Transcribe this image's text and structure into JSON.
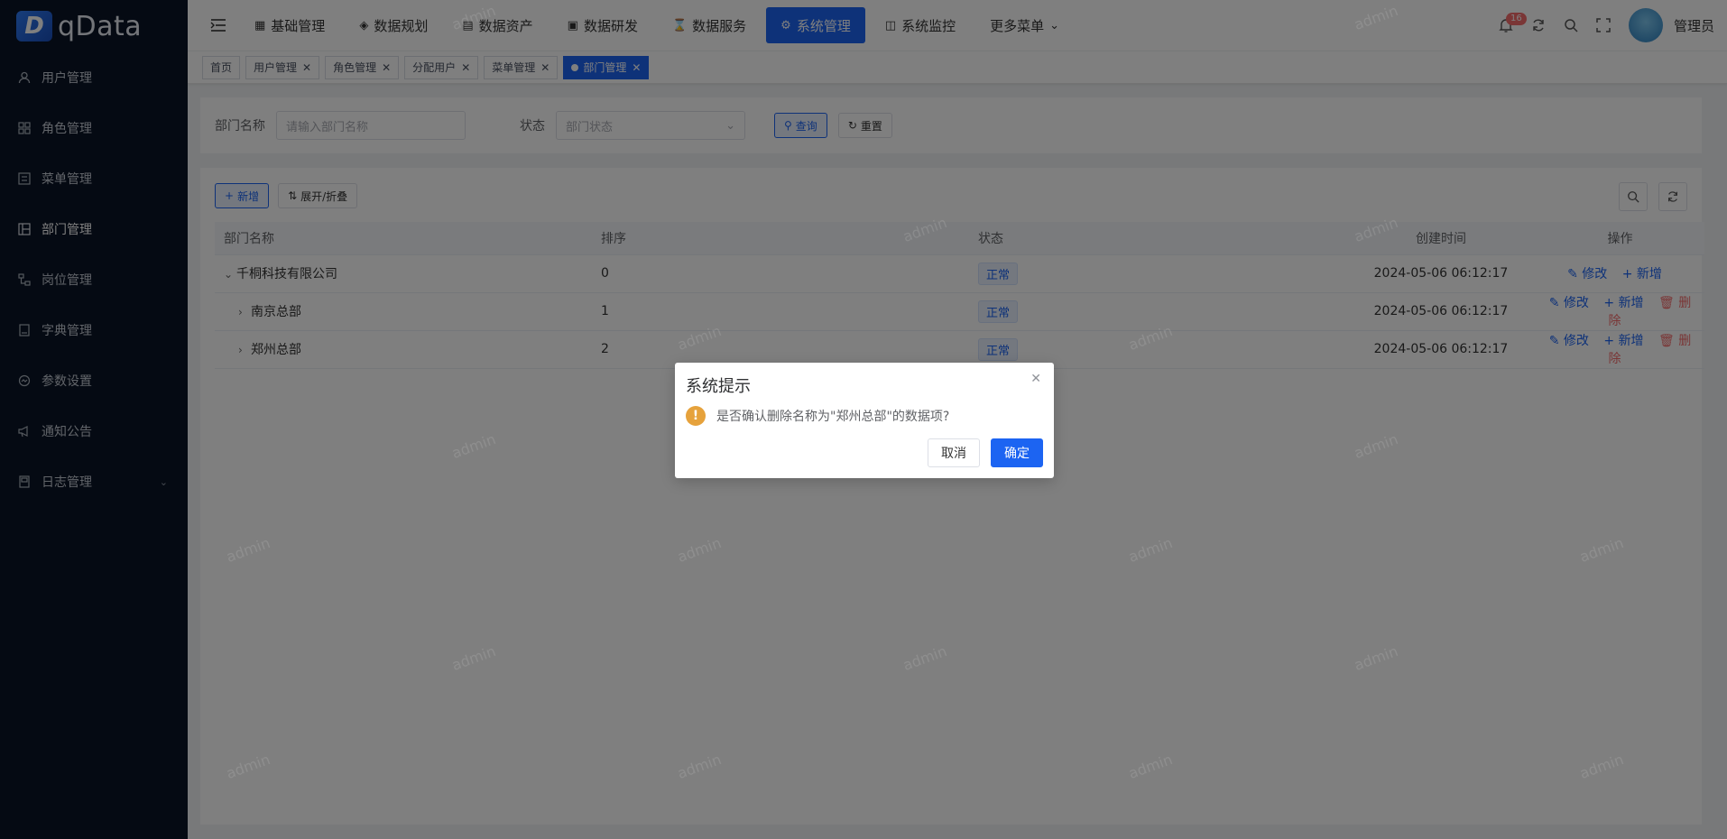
{
  "app": {
    "logo_letter": "D",
    "logo_text": "qData"
  },
  "sidebar": {
    "items": [
      {
        "label": "用户管理",
        "icon": "user-icon"
      },
      {
        "label": "角色管理",
        "icon": "role-icon"
      },
      {
        "label": "菜单管理",
        "icon": "menu-icon"
      },
      {
        "label": "部门管理",
        "icon": "department-icon"
      },
      {
        "label": "岗位管理",
        "icon": "post-icon"
      },
      {
        "label": "字典管理",
        "icon": "dictionary-icon"
      },
      {
        "label": "参数设置",
        "icon": "settings-icon"
      },
      {
        "label": "通知公告",
        "icon": "notice-icon"
      },
      {
        "label": "日志管理",
        "icon": "log-icon"
      }
    ]
  },
  "topnav": {
    "items": [
      {
        "label": "基础管理"
      },
      {
        "label": "数据规划"
      },
      {
        "label": "数据资产"
      },
      {
        "label": "数据研发"
      },
      {
        "label": "数据服务"
      },
      {
        "label": "系统管理"
      },
      {
        "label": "系统监控"
      },
      {
        "label": "更多菜单"
      }
    ],
    "notification_count": "16",
    "username": "管理员"
  },
  "tags": [
    {
      "label": "首页"
    },
    {
      "label": "用户管理"
    },
    {
      "label": "角色管理"
    },
    {
      "label": "分配用户"
    },
    {
      "label": "菜单管理"
    },
    {
      "label": "部门管理"
    }
  ],
  "search": {
    "dept_label": "部门名称",
    "dept_placeholder": "请输入部门名称",
    "status_label": "状态",
    "status_placeholder": "部门状态",
    "query_btn": "查询",
    "reset_btn": "重置"
  },
  "toolbar": {
    "add_btn": "新增",
    "expand_btn": "展开/折叠"
  },
  "table": {
    "headers": {
      "name": "部门名称",
      "order": "排序",
      "status": "状态",
      "created": "创建时间",
      "ops": "操作"
    },
    "rows": [
      {
        "name": "千桐科技有限公司",
        "order": "0",
        "status": "正常",
        "created": "2024-05-06 06:12:17",
        "edit": "修改",
        "add": "新增",
        "expanded": true
      },
      {
        "name": "南京总部",
        "order": "1",
        "status": "正常",
        "created": "2024-05-06 06:12:17",
        "edit": "修改",
        "add": "新增",
        "del": "删除"
      },
      {
        "name": "郑州总部",
        "order": "2",
        "status": "正常",
        "created": "2024-05-06 06:12:17",
        "edit": "修改",
        "add": "新增",
        "del": "删除"
      }
    ]
  },
  "watermark": "admin",
  "dialog": {
    "title": "系统提示",
    "message": "是否确认删除名称为\"郑州总部\"的数据项?",
    "cancel": "取消",
    "confirm": "确定"
  },
  "colors": {
    "primary": "#1c64f2",
    "sidebar_bg": "#0b1526",
    "danger": "#f56c6c",
    "warning": "#e6a23c"
  }
}
